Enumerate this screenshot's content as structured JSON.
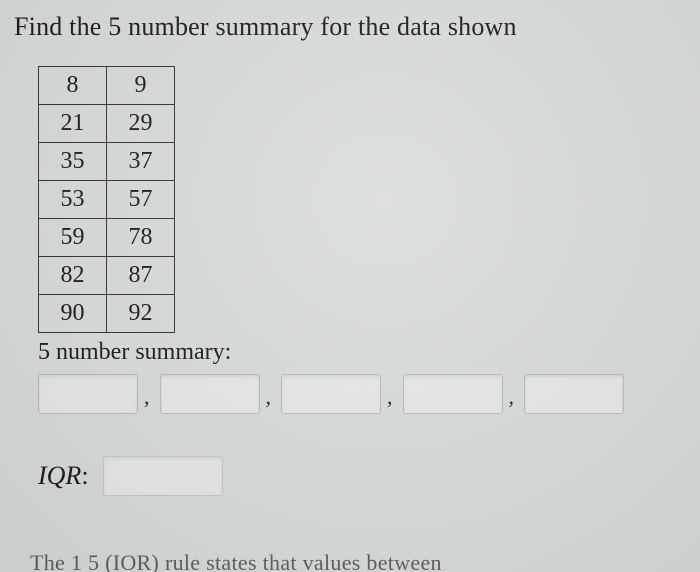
{
  "question_text": "Find the 5 number summary for the data shown",
  "table": {
    "rows": [
      [
        8,
        9
      ],
      [
        21,
        29
      ],
      [
        35,
        37
      ],
      [
        53,
        57
      ],
      [
        59,
        78
      ],
      [
        82,
        87
      ],
      [
        90,
        92
      ]
    ]
  },
  "summary_label": "5 number summary:",
  "answers": {
    "min": "",
    "q1": "",
    "median": "",
    "q3": "",
    "max": ""
  },
  "comma": ",",
  "iqr_label": "IQR",
  "iqr_colon": ":",
  "iqr_value": "",
  "cutoff_text": "The 1 5    (IOR) rule states that values between"
}
